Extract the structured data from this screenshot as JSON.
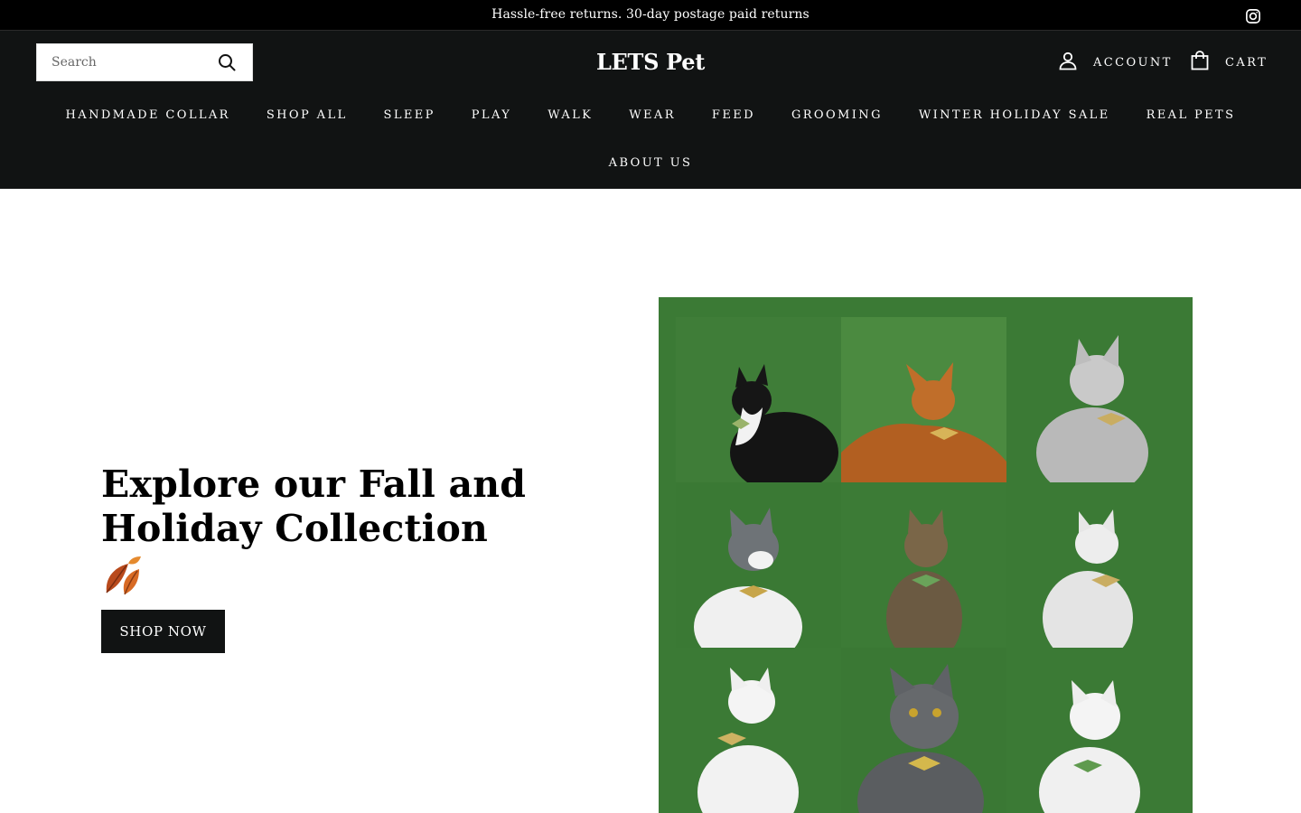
{
  "announcement": {
    "text": "Hassle-free returns. 30-day postage paid returns",
    "social_icon": "instagram-icon"
  },
  "header": {
    "search": {
      "placeholder": "Search",
      "icon": "search-icon"
    },
    "logo": "LETS Pet",
    "account_label": "ACCOUNT",
    "cart_label": "CART",
    "nav_row1": [
      "HANDMADE COLLAR",
      "SHOP ALL",
      "SLEEP",
      "PLAY",
      "WALK",
      "WEAR",
      "FEED",
      "GROOMING",
      "WINTER HOLIDAY SALE",
      "REAL PETS"
    ],
    "nav_row2": [
      "ABOUT US"
    ]
  },
  "hero": {
    "title": "Explore our Fall and Holiday Collection",
    "emoji_icon": "fallen-leaf-icon",
    "button_label": "SHOP NOW",
    "image_alt_subject": "nine cats wearing bow-tie collars on green background",
    "background_color": "#3b7a35"
  },
  "colors": {
    "header_bg": "#111313",
    "announcement_bg": "#000000",
    "accent_green": "#3b7a35"
  }
}
